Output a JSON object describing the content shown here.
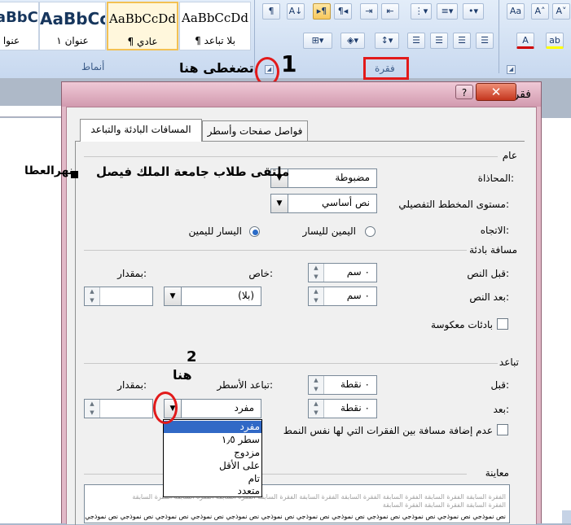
{
  "ribbon": {
    "styles": [
      {
        "sample": "AaBbCcDd",
        "label": "¶ بلا تباعد"
      },
      {
        "sample": "AaBbCcDd",
        "label": "¶ عادي"
      },
      {
        "sample": "AaBbCc",
        "label": "عنوان ١"
      },
      {
        "sample": "AaBbCc",
        "label": "عنوا"
      }
    ],
    "styles_group_label": "أنماط",
    "paragraph_group_label": "فقرة"
  },
  "annotations": {
    "step1_number": "1",
    "step1_text": "تضغطى هنا",
    "watermark": "ملتقى طلاب جامعة الملك فيصل",
    "author": "نهرالعطا",
    "step2_number": "2",
    "step2_text": "هنا"
  },
  "dialog": {
    "title": "فقرة",
    "tabs": [
      "المسافات البادئة والتباعد",
      "فواصل صفحات وأسطر"
    ],
    "general": {
      "heading": "عام",
      "alignment_label": "المحاذاة:",
      "alignment_value": "مضبوطة",
      "outline_label": "مستوى المخطط التفصيلي:",
      "outline_value": "نص أساسي",
      "direction_label": "الاتجاه:",
      "rtl_label": "اليمين لليسار",
      "ltr_label": "اليسار لليمين"
    },
    "indentation": {
      "heading": "مسافة بادئة",
      "before_label": "قبل النص:",
      "before_value": "٠ سم",
      "after_label": "بعد النص:",
      "after_value": "٠ سم",
      "special_label": "خاص:",
      "special_value": "(بلا)",
      "by_label": "بمقدار:",
      "mirror_label": "بادئات معكوسة"
    },
    "spacing": {
      "heading": "تباعد",
      "before_label": "قبل:",
      "before_value": "٠ نقطة",
      "after_label": "بعد:",
      "after_value": "٠ نقطة",
      "line_spacing_label": "تباعد الأسطر:",
      "line_spacing_value": "مفرد",
      "at_label": "بمقدار:",
      "dont_add_label": "عدم إضافة مسافة بين الفقرات التي لها نفس النمط",
      "line_spacing_options": [
        "مفرد",
        "سطر ١٫٥",
        "مزدوج",
        "على الأقل",
        "تام",
        "متعدد"
      ],
      "selected_option": "مفرد"
    },
    "preview": {
      "heading": "معاينة",
      "prev_text": "الفقرة السابقة الفقرة السابقة الفقرة السابقة الفقرة السابقة الفقرة السابقة الفقرة السابقة الفقرة السابقة الفقرة السابقة الفقرة السابقة",
      "prev_text2": "الفقرة السابقة الفقرة السابقة الفقرة السابقة",
      "sample_text": "نص نموذجي نص نموذجي نص نموذجي نص نموذجي نص نموذجي نص نموذجي نص نموذجي نص نموذجي نص نموذجي نص نموذجي نص نموذجي نص نموذجي"
    }
  },
  "colors": {
    "annotation_red": "#e21a1a",
    "dialog_frame": "#e2b9c8",
    "selection_blue": "#3169c6"
  }
}
